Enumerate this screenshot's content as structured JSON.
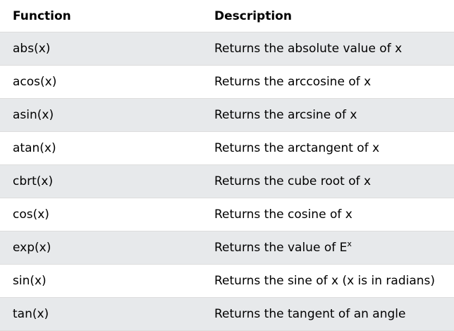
{
  "table": {
    "headers": {
      "function": "Function",
      "description": "Description"
    },
    "rows": [
      {
        "function": "abs(x)",
        "description": "Returns the absolute value of x"
      },
      {
        "function": "acos(x)",
        "description": "Returns the arccosine of x"
      },
      {
        "function": "asin(x)",
        "description": "Returns the arcsine of x"
      },
      {
        "function": "atan(x)",
        "description": "Returns the arctangent of x"
      },
      {
        "function": "cbrt(x)",
        "description": "Returns the cube root of x"
      },
      {
        "function": "cos(x)",
        "description": "Returns the cosine of x"
      },
      {
        "function": "exp(x)",
        "description": "Returns the value of E",
        "description_sup": "x"
      },
      {
        "function": "sin(x)",
        "description": "Returns the sine of x (x is in radians)"
      },
      {
        "function": "tan(x)",
        "description": "Returns the tangent of an angle"
      }
    ]
  }
}
